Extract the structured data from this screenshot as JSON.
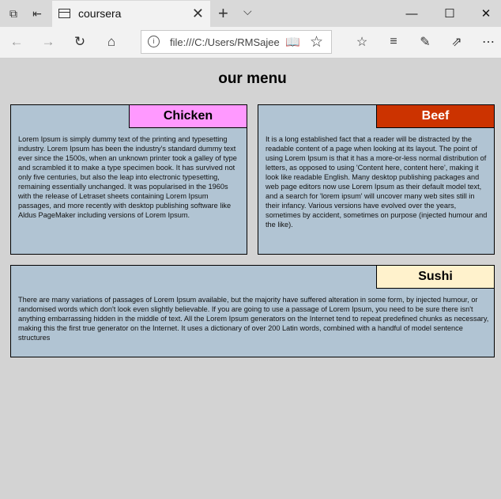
{
  "browser": {
    "tab_title": "coursera",
    "address": "file:///C:/Users/RMSajee"
  },
  "page": {
    "heading": "our menu",
    "sections": [
      {
        "title": "Chicken",
        "color": "#ff99ff",
        "text_color": "#000000",
        "text": "Lorem Ipsum is simply dummy text of the printing and typesetting industry. Lorem Ipsum has been the industry's standard dummy text ever since the 1500s, when an unknown printer took a galley of type and scrambled it to make a type specimen book. It has survived not only five centuries, but also the leap into electronic typesetting, remaining essentially unchanged. It was popularised in the 1960s with the release of Letraset sheets containing Lorem Ipsum passages, and more recently with desktop publishing software like Aldus PageMaker including versions of Lorem Ipsum."
      },
      {
        "title": "Beef",
        "color": "#cc3300",
        "text_color": "#ffffff",
        "text": "It is a long established fact that a reader will be distracted by the readable content of a page when looking at its layout. The point of using Lorem Ipsum is that it has a more-or-less normal distribution of letters, as opposed to using 'Content here, content here', making it look like readable English. Many desktop publishing packages and web page editors now use Lorem Ipsum as their default model text, and a search for 'lorem ipsum' will uncover many web sites still in their infancy. Various versions have evolved over the years, sometimes by accident, sometimes on purpose (injected humour and the like)."
      },
      {
        "title": "Sushi",
        "color": "#fff2cc",
        "text_color": "#000000",
        "text": "There are many variations of passages of Lorem Ipsum available, but the majority have suffered alteration in some form, by injected humour, or randomised words which don't look even slightly believable. If you are going to use a passage of Lorem Ipsum, you need to be sure there isn't anything embarrassing hidden in the middle of text. All the Lorem Ipsum generators on the Internet tend to repeat predefined chunks as necessary, making this the first true generator on the Internet. It uses a dictionary of over 200 Latin words, combined with a handful of model sentence structures"
      }
    ]
  }
}
